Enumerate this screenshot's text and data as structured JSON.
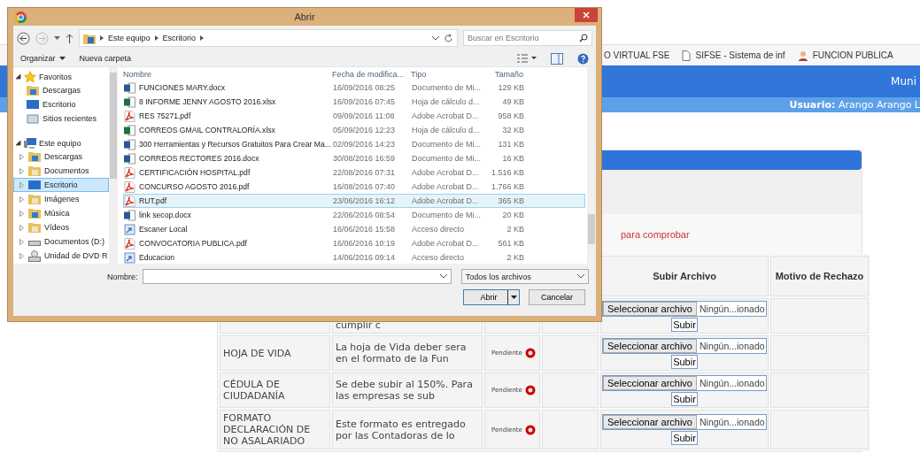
{
  "browser": {
    "bookmarks": [
      {
        "label": "O VIRTUAL FSE",
        "kind": "plain"
      },
      {
        "label": "SIFSE - Sistema de inf",
        "kind": "page"
      },
      {
        "label": "FUNCION PUBLICA",
        "kind": "person"
      }
    ],
    "header_title": "Muni",
    "user_label": "Usuario:",
    "user_name": "Arango Arango L"
  },
  "panel": {
    "message": "para comprobar",
    "columns": [
      "Subir Archivo",
      "Motivo de Rechazo"
    ],
    "rows": [
      {
        "document": "",
        "description": "cumplir c",
        "status": "",
        "select_button": "Seleccionar archivo",
        "file_status": "Ningún...ionado",
        "upload_button": "Subir"
      },
      {
        "document": "HOJA DE VIDA",
        "description": "La hoja de Vida deber sera en el formato de la Fun",
        "status": "Pendiente",
        "select_button": "Seleccionar archivo",
        "file_status": "Ningún...ionado",
        "upload_button": "Subir"
      },
      {
        "document": "CÉDULA DE CIUDADANÍA",
        "description": "Se debe subir al 150%. Para las empresas se sub",
        "status": "Pendiente",
        "select_button": "Seleccionar archivo",
        "file_status": "Ningún...ionado",
        "upload_button": "Subir"
      },
      {
        "document": "FORMATO DECLARACIÓN DE NO ASALARIADO",
        "description": "Este formato es entregado por las Contadoras de lo",
        "status": "Pendiente",
        "select_button": "Seleccionar archivo",
        "file_status": "Ningún...ionado",
        "upload_button": "Subir"
      }
    ]
  },
  "dialog": {
    "title": "Abrir",
    "path": [
      "Este equipo",
      "Escritorio"
    ],
    "search_placeholder": "Buscar en Escritorio",
    "toolbar": [
      "Organizar",
      "Nueva carpeta"
    ],
    "nav": [
      {
        "label": "Favoritos",
        "kind": "star",
        "expanded": true,
        "children": [
          {
            "label": "Descargas",
            "kind": "download",
            "selected": false
          },
          {
            "label": "Escritorio",
            "kind": "desktop",
            "selected": false
          },
          {
            "label": "Sitios recientes",
            "kind": "recent",
            "selected": false
          }
        ]
      },
      {
        "label": "Este equipo",
        "kind": "computer",
        "expanded": true,
        "children": [
          {
            "label": "Descargas",
            "kind": "download",
            "selected": false
          },
          {
            "label": "Documentos",
            "kind": "docs",
            "selected": false
          },
          {
            "label": "Escritorio",
            "kind": "desktop",
            "selected": true
          },
          {
            "label": "Imágenes",
            "kind": "docs",
            "selected": false
          },
          {
            "label": "Música",
            "kind": "download",
            "selected": false
          },
          {
            "label": "Vídeos",
            "kind": "docs",
            "selected": false
          },
          {
            "label": "Documentos (D:)",
            "kind": "drive",
            "selected": false
          },
          {
            "label": "Unidad de DVD R",
            "kind": "dvd",
            "selected": false
          }
        ]
      }
    ],
    "columns": [
      "Nombre",
      "Fecha de modifica...",
      "Tipo",
      "Tamaño"
    ],
    "files": [
      {
        "name": "FUNCIONES MARY.docx",
        "date": "16/09/2016 08:25",
        "type": "Documento de Mi...",
        "size": "129 KB",
        "kind": "word",
        "selected": false
      },
      {
        "name": "8 INFORME JENNY AGOSTO 2016.xlsx",
        "date": "16/09/2016 07:45",
        "type": "Hoja de cálculo d...",
        "size": "49 KB",
        "kind": "excel",
        "selected": false
      },
      {
        "name": "RES 75271.pdf",
        "date": "09/09/2016 11:08",
        "type": "Adobe Acrobat D...",
        "size": "958 KB",
        "kind": "pdf",
        "selected": false
      },
      {
        "name": "CORREOS GMAIL CONTRALORÍA.xlsx",
        "date": "05/09/2016 12:23",
        "type": "Hoja de cálculo d...",
        "size": "32 KB",
        "kind": "excel",
        "selected": false
      },
      {
        "name": "300 Herramientas y Recursos Gratuitos Para Crear Ma...",
        "date": "02/09/2016 14:23",
        "type": "Documento de Mi...",
        "size": "131 KB",
        "kind": "word",
        "selected": false
      },
      {
        "name": "CORREOS RECTORES 2016.docx",
        "date": "30/08/2016 16:59",
        "type": "Documento de Mi...",
        "size": "16 KB",
        "kind": "word",
        "selected": false
      },
      {
        "name": "CERTIFICACIÓN HOSPITAL.pdf",
        "date": "22/08/2016 07:31",
        "type": "Adobe Acrobat D...",
        "size": "1.516 KB",
        "kind": "pdf",
        "selected": false
      },
      {
        "name": "CONCURSO AGOSTO 2016.pdf",
        "date": "16/08/2016 07:40",
        "type": "Adobe Acrobat D...",
        "size": "1.766 KB",
        "kind": "pdf",
        "selected": false
      },
      {
        "name": "RUT.pdf",
        "date": "23/06/2016 16:12",
        "type": "Adobe Acrobat D...",
        "size": "365 KB",
        "kind": "pdf",
        "selected": true
      },
      {
        "name": "link secop.docx",
        "date": "22/06/2016 08:54",
        "type": "Documento de Mi...",
        "size": "20 KB",
        "kind": "word",
        "selected": false
      },
      {
        "name": "Escaner Local",
        "date": "16/06/2016 15:58",
        "type": "Acceso directo",
        "size": "2 KB",
        "kind": "shortcut",
        "selected": false
      },
      {
        "name": "CONVOCATORIA PUBLICA.pdf",
        "date": "16/06/2016 10:19",
        "type": "Adobe Acrobat D...",
        "size": "561 KB",
        "kind": "pdf",
        "selected": false
      },
      {
        "name": "Educacion",
        "date": "14/06/2016 09:14",
        "type": "Acceso directo",
        "size": "2 KB",
        "kind": "shortcut",
        "selected": false
      }
    ],
    "name_label": "Nombre:",
    "filter": "Todos los archivos",
    "open_button": "Abrir",
    "cancel_button": "Cancelar"
  }
}
